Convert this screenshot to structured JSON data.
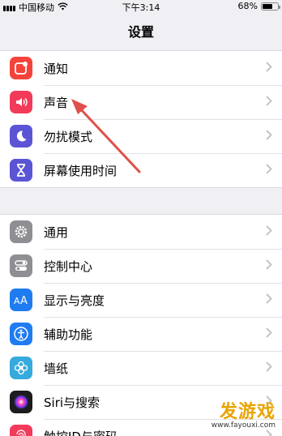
{
  "status_bar": {
    "carrier": "中国移动",
    "time": "下午3:14",
    "battery": "68%",
    "battery_level": 0.68
  },
  "nav": {
    "title": "设置"
  },
  "groups": [
    {
      "items": [
        {
          "label": "通知",
          "icon": "notification-icon",
          "color": "#f3433b"
        },
        {
          "label": "声音",
          "icon": "sound-icon",
          "color": "#f23a5a"
        },
        {
          "label": "勿扰模式",
          "icon": "moon-icon",
          "color": "#5b55d6"
        },
        {
          "label": "屏幕使用时间",
          "icon": "hourglass-icon",
          "color": "#5b55d6"
        }
      ]
    },
    {
      "items": [
        {
          "label": "通用",
          "icon": "gear-icon",
          "color": "#8e8e93"
        },
        {
          "label": "控制中心",
          "icon": "toggles-icon",
          "color": "#8e8e93"
        },
        {
          "label": "显示与亮度",
          "icon": "text-size-icon",
          "color": "#1f7cf0"
        },
        {
          "label": "辅助功能",
          "icon": "accessibility-icon",
          "color": "#1f7cf0"
        },
        {
          "label": "墙纸",
          "icon": "flower-icon",
          "color": "#35aadc"
        },
        {
          "label": "Siri与搜索",
          "icon": "siri-icon",
          "color": "#1c1c1e"
        },
        {
          "label": "触控ID与密码",
          "icon": "fingerprint-icon",
          "color": "#f23a5a"
        }
      ]
    }
  ],
  "watermark": {
    "title": "发游戏",
    "url": "www.fayouxi.com"
  },
  "annotation_color": "#e0504a"
}
